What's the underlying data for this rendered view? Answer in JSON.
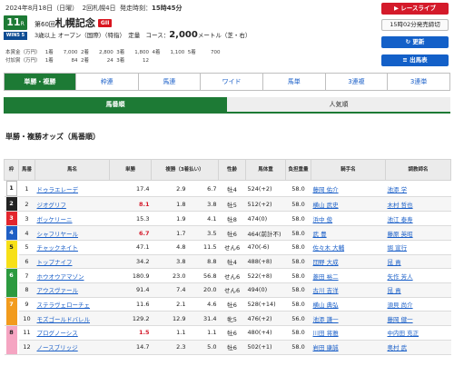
{
  "header": {
    "date_line_date": "2024年8月18日（日曜）",
    "date_line_meeting": "2回札幌4日",
    "date_line_post": "発走時刻：",
    "date_line_time": "15時45分",
    "race_number": "11",
    "race_number_suffix": "R",
    "race_kai": "第60回",
    "race_name": "札幌記念",
    "grade": "GII",
    "win5_badge": "WIN5 5",
    "conditions": "3歳以上 オープン（国際）（特指）　定量",
    "course_label": "コース：",
    "distance": "2,000",
    "distance_unit": "メートル（芝・右）",
    "prize_row1": [
      "本賞金（万円）",
      "1着",
      "7,000",
      "2着",
      "2,800",
      "3着",
      "1,800",
      "4着",
      "1,100",
      "5着",
      "700"
    ],
    "prize_row2": [
      "付加賞（万円）",
      "1着",
      "84",
      "2着",
      "24",
      "3着",
      "12"
    ]
  },
  "side_buttons": {
    "live": "▶ レースライブ",
    "deadline": "15時02分発売締切",
    "update": "↻ 更新",
    "entries": "≡ 出馬表"
  },
  "bet_tabs": [
    "単勝・複勝",
    "枠連",
    "馬連",
    "ワイド",
    "馬単",
    "3連複",
    "3連単"
  ],
  "sort_tabs": [
    "馬番順",
    "人気順"
  ],
  "section_title": "単勝・複勝オッズ（馬番順）",
  "table": {
    "headers": [
      "枠",
      "馬番",
      "馬名",
      "単勝",
      "複勝（3着払い）",
      "",
      "性齢",
      "馬体重",
      "負担重量",
      "騎手名",
      "調教師名"
    ],
    "rows": [
      {
        "waku": "1",
        "umaban": "1",
        "name": "ドゥラエレーデ",
        "win": "17.4",
        "place_lo": "2.9",
        "place_hi": "6.7",
        "sexage": "牡4",
        "weight": "524(+2)",
        "burden": "58.0",
        "jockey": "藤岡 佑介",
        "trainer": "池添 学",
        "win_red": false
      },
      {
        "waku": "2",
        "umaban": "2",
        "name": "ジオグリフ",
        "win": "8.1",
        "place_lo": "1.8",
        "place_hi": "3.8",
        "sexage": "牡5",
        "weight": "512(+2)",
        "burden": "58.0",
        "jockey": "横山 武史",
        "trainer": "木村 哲也",
        "win_red": true
      },
      {
        "waku": "3",
        "umaban": "3",
        "name": "ボッケリーニ",
        "win": "15.3",
        "place_lo": "1.9",
        "place_hi": "4.1",
        "sexage": "牡8",
        "weight": "474(0)",
        "burden": "58.0",
        "jockey": "浜中 俊",
        "trainer": "池江 泰寿",
        "win_red": false
      },
      {
        "waku": "4",
        "umaban": "4",
        "name": "シャフリヤール",
        "win": "6.7",
        "place_lo": "1.7",
        "place_hi": "3.5",
        "sexage": "牡6",
        "weight": "464(前計不)",
        "burden": "58.0",
        "jockey": "武 豊",
        "trainer": "藤原 英昭",
        "win_red": true
      },
      {
        "waku": "5",
        "umaban": "5",
        "name": "チャックネイト",
        "win": "47.1",
        "place_lo": "4.8",
        "place_hi": "11.5",
        "sexage": "せん6",
        "weight": "470(-6)",
        "burden": "58.0",
        "jockey": "佐々木 大輔",
        "trainer": "堀 宣行",
        "win_red": false
      },
      {
        "waku": "5",
        "umaban": "6",
        "name": "トップナイフ",
        "win": "34.2",
        "place_lo": "3.8",
        "place_hi": "8.8",
        "sexage": "牡4",
        "weight": "488(+8)",
        "burden": "58.0",
        "jockey": "団野 大成",
        "trainer": "昆 貢",
        "win_red": false
      },
      {
        "waku": "6",
        "umaban": "7",
        "name": "ホウオウアマゾン",
        "win": "180.9",
        "place_lo": "23.0",
        "place_hi": "56.8",
        "sexage": "せん6",
        "weight": "522(+8)",
        "burden": "58.0",
        "jockey": "菱田 裕二",
        "trainer": "矢作 芳人",
        "win_red": false
      },
      {
        "waku": "6",
        "umaban": "8",
        "name": "アウスヴァール",
        "win": "91.4",
        "place_lo": "7.4",
        "place_hi": "20.0",
        "sexage": "せん6",
        "weight": "494(0)",
        "burden": "58.0",
        "jockey": "古川 吉洋",
        "trainer": "昆 貢",
        "win_red": false
      },
      {
        "waku": "7",
        "umaban": "9",
        "name": "ステラヴェローチェ",
        "win": "11.6",
        "place_lo": "2.1",
        "place_hi": "4.6",
        "sexage": "牡6",
        "weight": "528(+14)",
        "burden": "58.0",
        "jockey": "横山 典弘",
        "trainer": "須貝 尚介",
        "win_red": false
      },
      {
        "waku": "7",
        "umaban": "10",
        "name": "モズゴールドバレル",
        "win": "129.2",
        "place_lo": "12.9",
        "place_hi": "31.4",
        "sexage": "牝5",
        "weight": "476(+2)",
        "burden": "56.0",
        "jockey": "池添 謙一",
        "trainer": "藤岡 健一",
        "win_red": false
      },
      {
        "waku": "8",
        "umaban": "11",
        "name": "プログノーシス",
        "win": "1.5",
        "place_lo": "1.1",
        "place_hi": "1.1",
        "sexage": "牡6",
        "weight": "480(+4)",
        "burden": "58.0",
        "jockey": "川田 将雅",
        "trainer": "中内田 充正",
        "win_red": true
      },
      {
        "waku": "8",
        "umaban": "12",
        "name": "ノースブリッジ",
        "win": "14.7",
        "place_lo": "2.3",
        "place_hi": "5.0",
        "sexage": "牡6",
        "weight": "502(+1)",
        "burden": "58.0",
        "jockey": "岩田 康誠",
        "trainer": "奥村 武",
        "win_red": false
      }
    ]
  },
  "colors": {
    "accent_green": "#1d7a35",
    "link_blue": "#1a5fc8",
    "odds_red": "#d41a2a",
    "waku": {
      "1": [
        "#ffffff",
        "#222222"
      ],
      "2": [
        "#222222",
        "#ffffff"
      ],
      "3": [
        "#e3262d",
        "#ffffff"
      ],
      "4": [
        "#1f5fc4",
        "#ffffff"
      ],
      "5": [
        "#f7e017",
        "#222222"
      ],
      "6": [
        "#2c9a3f",
        "#ffffff"
      ],
      "7": [
        "#f29b1d",
        "#ffffff"
      ],
      "8": [
        "#f5a5c2",
        "#222222"
      ]
    }
  }
}
